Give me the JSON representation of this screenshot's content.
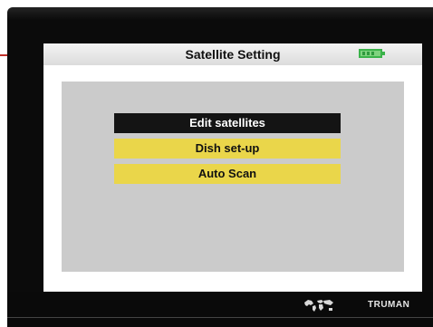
{
  "header": {
    "title": "Satellite Setting",
    "battery_icon": "battery-icon",
    "battery_color": "#3bb34a"
  },
  "menu": {
    "items": [
      {
        "label": "Edit satellites",
        "selected": true
      },
      {
        "label": "Dish set-up",
        "selected": false
      },
      {
        "label": "Auto Scan",
        "selected": false
      }
    ]
  },
  "footer": {
    "map_icon": "world-map-icon",
    "brand": "TRUMAN"
  },
  "colors": {
    "selected_bg": "#141414",
    "item_bg": "#ead64a",
    "panel_bg": "#cbcbcb",
    "accent_red": "#c0302a"
  }
}
